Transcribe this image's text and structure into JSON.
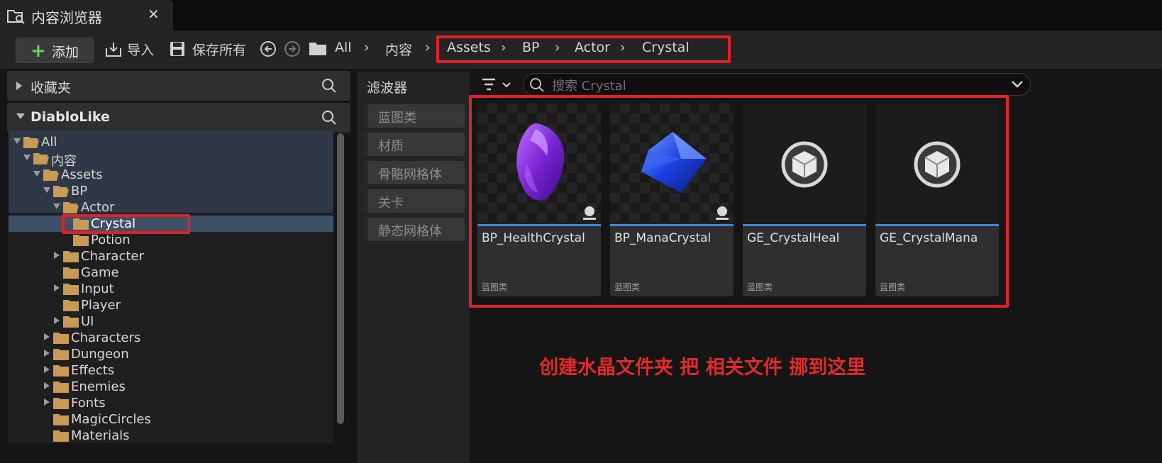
{
  "tab": {
    "title": "内容浏览器",
    "close": "✕"
  },
  "toolbar": {
    "add_label": "添加",
    "import_label": "导入",
    "save_all_label": "保存所有",
    "breadcrumbs": [
      "All",
      "内容",
      "Assets",
      "BP",
      "Actor",
      "Crystal"
    ]
  },
  "sidebar": {
    "favorites_title": "收藏夹",
    "project_title": "DiabloLike",
    "tree": [
      {
        "label": "All",
        "depth": 0,
        "expanded": true
      },
      {
        "label": "内容",
        "depth": 1,
        "expanded": true
      },
      {
        "label": "Assets",
        "depth": 2,
        "expanded": true
      },
      {
        "label": "BP",
        "depth": 3,
        "expanded": true
      },
      {
        "label": "Actor",
        "depth": 4,
        "expanded": true
      },
      {
        "label": "Crystal",
        "depth": 5,
        "selected": true
      },
      {
        "label": "Potion",
        "depth": 5
      },
      {
        "label": "Character",
        "depth": 4,
        "collapsed": true
      },
      {
        "label": "Game",
        "depth": 4
      },
      {
        "label": "Input",
        "depth": 4,
        "collapsed": true
      },
      {
        "label": "Player",
        "depth": 4
      },
      {
        "label": "UI",
        "depth": 4,
        "collapsed": true
      },
      {
        "label": "Characters",
        "depth": 3,
        "collapsed": true
      },
      {
        "label": "Dungeon",
        "depth": 3,
        "collapsed": true
      },
      {
        "label": "Effects",
        "depth": 3,
        "collapsed": true
      },
      {
        "label": "Enemies",
        "depth": 3,
        "collapsed": true
      },
      {
        "label": "Fonts",
        "depth": 3,
        "collapsed": true
      },
      {
        "label": "MagicCircles",
        "depth": 3
      },
      {
        "label": "Materials",
        "depth": 3
      }
    ]
  },
  "filters": {
    "title": "滤波器",
    "chips": [
      "蓝图类",
      "材质",
      "骨骼网格体",
      "关卡",
      "静态网格体"
    ]
  },
  "search": {
    "placeholder": "搜索 Crystal"
  },
  "assets": [
    {
      "name": "BP_HealthCrystal",
      "type": "蓝图类",
      "thumb": "purple-crystal"
    },
    {
      "name": "BP_ManaCrystal",
      "type": "蓝图类",
      "thumb": "blue-crystal"
    },
    {
      "name": "GE_CrystalHeal",
      "type": "蓝图类",
      "thumb": "cube-icon"
    },
    {
      "name": "GE_CrystalMana",
      "type": "蓝图类",
      "thumb": "cube-icon"
    }
  ],
  "annotation": "创建水晶文件夹 把 相关文件 挪到这里",
  "colors": {
    "highlight_red": "#e0212a",
    "accent_blue": "#3b87e6",
    "folder": "#c89a56"
  }
}
